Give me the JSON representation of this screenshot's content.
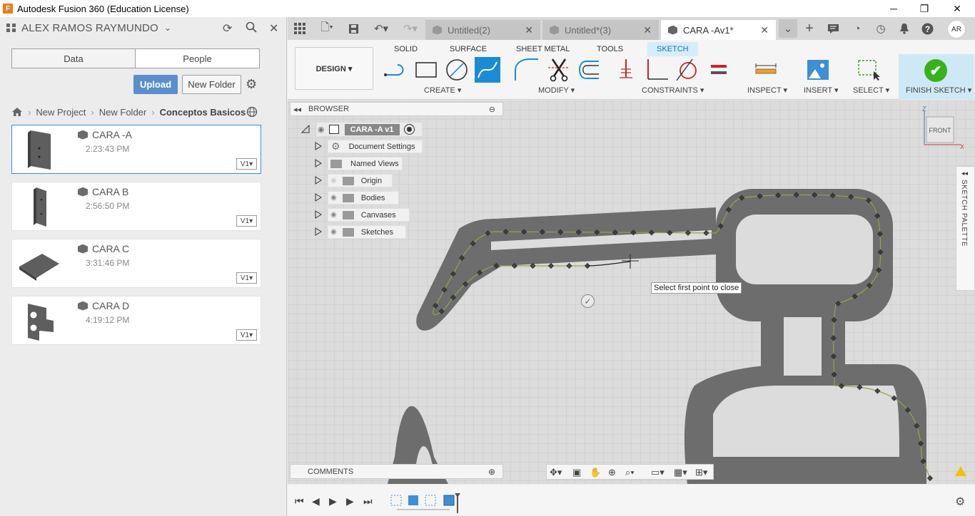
{
  "window": {
    "title": "Autodesk Fusion 360 (Education License)",
    "logo_letter": "F",
    "controls": {
      "minimize": "─",
      "restore": "❐",
      "close": "✕"
    }
  },
  "data_panel": {
    "user_name": "ALEX RAMOS RAYMUNDO",
    "tabs": [
      "Data",
      "People"
    ],
    "upload_label": "Upload",
    "new_folder_label": "New Folder",
    "breadcrumb": [
      "New Project",
      "New Folder",
      "Conceptos Basicos"
    ],
    "files": [
      {
        "name": "CARA -A",
        "time": "2:23:43 PM",
        "version": "V1▾"
      },
      {
        "name": "CARA B",
        "time": "2:56:50 PM",
        "version": "V1▾"
      },
      {
        "name": "CARA C",
        "time": "3:31:46 PM",
        "version": "V1▾"
      },
      {
        "name": "CARA D",
        "time": "4:19:12 PM",
        "version": "V1▾"
      }
    ]
  },
  "doc_tabs": [
    {
      "label": "Untitled(2)"
    },
    {
      "label": "Untitled*(3)"
    },
    {
      "label": "CARA -Av1*"
    }
  ],
  "avatar_initials": "AR",
  "toolbar": {
    "workspace": "DESIGN ▾",
    "tabs": [
      "SOLID",
      "SURFACE",
      "SHEET METAL",
      "TOOLS",
      "SKETCH"
    ],
    "groups": [
      "CREATE ▾",
      "MODIFY ▾",
      "CONSTRAINTS ▾",
      "INSPECT ▾",
      "INSERT ▾",
      "SELECT ▾",
      "FINISH SKETCH ▾"
    ]
  },
  "browser": {
    "title": "BROWSER",
    "root": "CARA -A v1",
    "items": [
      "Document Settings",
      "Named Views",
      "Origin",
      "Bodies",
      "Canvases",
      "Sketches"
    ]
  },
  "tooltip": "Select first point to close",
  "viewcube": {
    "face": "FRONT",
    "axis_z": "Z",
    "axis_x": "X"
  },
  "sketch_palette": "SKETCH PALETTE",
  "comments": "COMMENTS",
  "colors": {
    "accent": "#1a8bd4",
    "finish": "#37b21b",
    "upload": "#5a8fcb"
  }
}
